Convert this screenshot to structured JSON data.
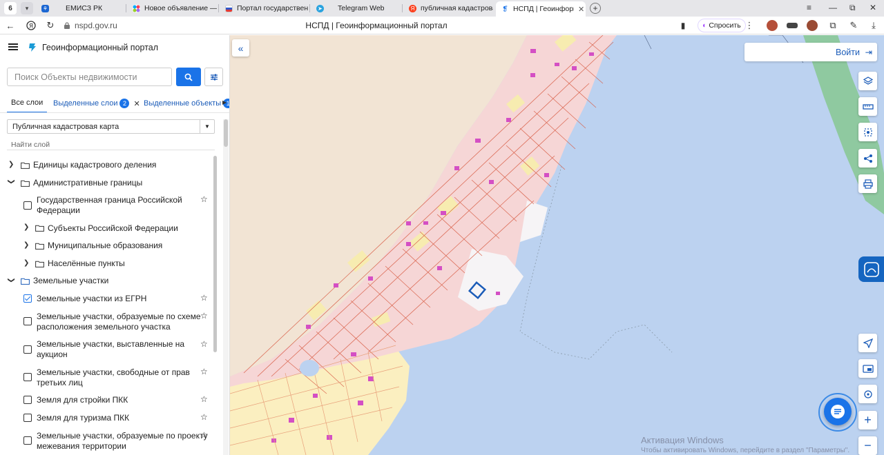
{
  "browser": {
    "tab_count": "6",
    "tabs": [
      {
        "label": "ЕМИСЗ РК",
        "icon": "emisz-icon"
      },
      {
        "label": "Новое объявление — Об",
        "icon": "avito-icon"
      },
      {
        "label": "Портал государственны",
        "icon": "gosuslugi-icon"
      },
      {
        "label": "Telegram Web",
        "icon": "telegram-icon"
      },
      {
        "label": "публичная кадастровая к",
        "icon": "yandex-icon"
      },
      {
        "label": "НСПД | Геоинформацио",
        "icon": "nspd-icon",
        "active": true
      }
    ],
    "url": "nspd.gov.ru",
    "page_title": "НСПД | Геоинформационный портал",
    "ask_label": "Спросить"
  },
  "panel": {
    "portal_name": "Геоинформационный портал",
    "search_placeholder": "Поиск Объекты недвижимости",
    "tabs": [
      {
        "label": "Все слои"
      },
      {
        "label": "Выделенные слои",
        "badge": "2"
      },
      {
        "label": "Выделенные объекты",
        "badge": "1"
      }
    ],
    "select_value": "Публичная кадастровая карта",
    "find_layer": "Найти слой",
    "tree": [
      {
        "label": "Единицы кадастрового деления"
      },
      {
        "label": "Административные границы"
      },
      {
        "label": "Государственная граница Российской",
        "label2": "Федерации"
      },
      {
        "label": "Субъекты Российской Федерации"
      },
      {
        "label": "Муниципальные образования"
      },
      {
        "label": "Населённые пункты"
      },
      {
        "label": "Земельные участки"
      },
      {
        "label": "Земельные участки из ЕГРН"
      },
      {
        "label": "Земельные участки, образуемые по схеме",
        "label2": "расположения земельного участка"
      },
      {
        "label": "Земельные участки, выставленные на",
        "label2": "аукцион"
      },
      {
        "label": "Земельные участки, свободные от прав",
        "label2": "третьих лиц"
      },
      {
        "label": "Земля для стройки ПКК"
      },
      {
        "label": "Земля для туризма ПКК"
      },
      {
        "label": "Земельные участки, образуемые по проекту",
        "label2": "межевания территории"
      }
    ]
  },
  "map": {
    "login_label": "Войти",
    "activation_title": "Активация Windows",
    "activation_sub": "Чтобы активировать Windows, перейдите в раздел \"Параметры\".",
    "colors": {
      "water": "#bcd2f0",
      "sand": "#f2e4d4",
      "parcel": "#f6d6d6",
      "parcel_border": "#d9614a",
      "building": "#d44fc4",
      "selected": "#1a5bb8"
    }
  }
}
